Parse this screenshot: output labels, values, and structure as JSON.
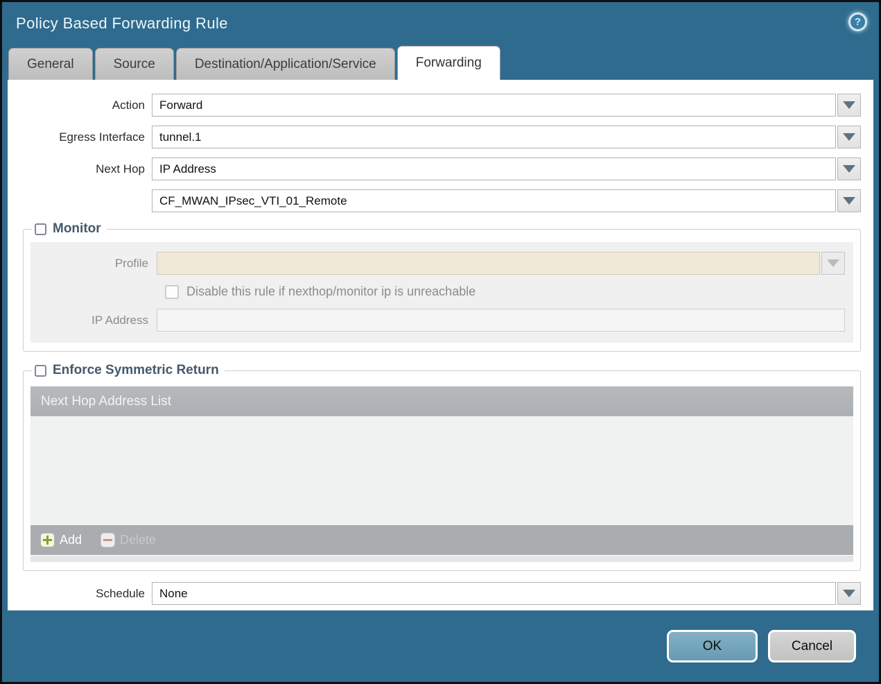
{
  "window": {
    "title": "Policy Based Forwarding Rule"
  },
  "icons": {
    "help": "?"
  },
  "tabs": [
    {
      "label": "General",
      "active": false
    },
    {
      "label": "Source",
      "active": false
    },
    {
      "label": "Destination/Application/Service",
      "active": false
    },
    {
      "label": "Forwarding",
      "active": true
    }
  ],
  "form": {
    "action": {
      "label": "Action",
      "value": "Forward"
    },
    "egress_interface": {
      "label": "Egress Interface",
      "value": "tunnel.1"
    },
    "next_hop": {
      "label": "Next Hop",
      "value": "IP Address"
    },
    "next_hop_address": {
      "value": "CF_MWAN_IPsec_VTI_01_Remote"
    },
    "schedule": {
      "label": "Schedule",
      "value": "None"
    }
  },
  "monitor": {
    "title": "Monitor",
    "checked": false,
    "profile": {
      "label": "Profile",
      "value": ""
    },
    "disable_rule": {
      "label": "Disable this rule if nexthop/monitor ip is unreachable",
      "checked": false
    },
    "ip_address": {
      "label": "IP Address",
      "value": ""
    }
  },
  "enforce_symmetric_return": {
    "title": "Enforce Symmetric Return",
    "checked": false,
    "list": {
      "header": "Next Hop Address List",
      "rows": [],
      "add_label": "Add",
      "delete_label": "Delete"
    }
  },
  "footer": {
    "ok_label": "OK",
    "cancel_label": "Cancel"
  },
  "colors": {
    "frame_teal": "#2f6b8e",
    "section_title": "#44596b",
    "disabled_field_bg": "#f0e9d7",
    "table_header_bg": "#b1b5b8",
    "table_footer_bg": "#a9adb0",
    "table_body_bg": "#f0f1f1",
    "ok_button_bg": "#6fa2b8",
    "cancel_button_bg": "#c9c9c9",
    "add_icon_green": "#8a9e28",
    "delete_icon_red": "#d28f8f"
  }
}
